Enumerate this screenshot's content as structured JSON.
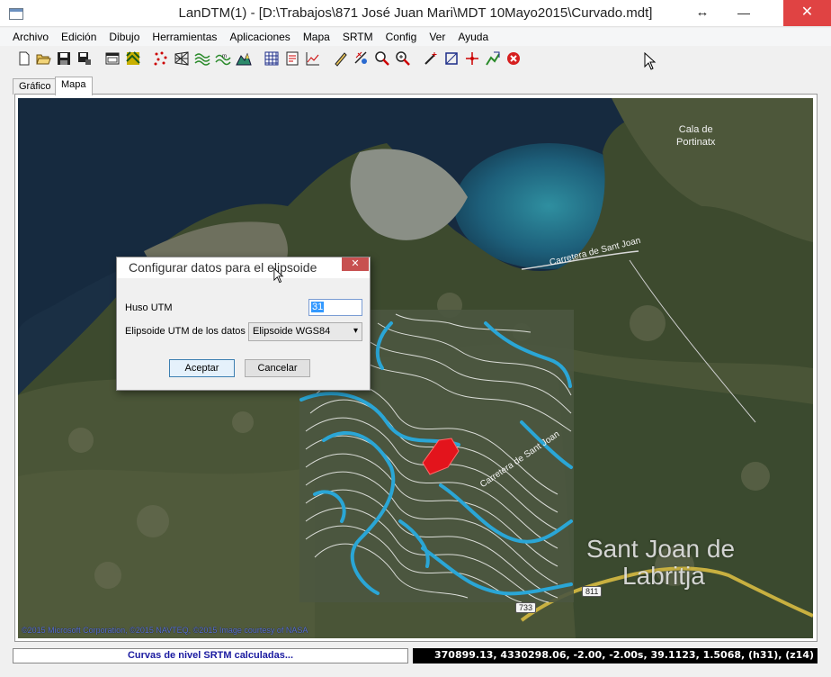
{
  "window": {
    "title": "LanDTM(1) - [D:\\Trabajos\\871 José Juan Mari\\MDT 10Mayo2015\\Curvado.mdt]",
    "resize_glyph": "↔",
    "minimize_glyph": "—",
    "maximize_glyph": "□",
    "close_glyph": "✕"
  },
  "menu": [
    "Archivo",
    "Edición",
    "Dibujo",
    "Herramientas",
    "Aplicaciones",
    "Mapa",
    "SRTM",
    "Config",
    "Ver",
    "Ayuda"
  ],
  "toolbar": {
    "icons": [
      "new-file-icon",
      "open-folder-icon",
      "save-icon",
      "save-as-icon",
      "window-icon",
      "texture-icon",
      "points-icon",
      "grid-mesh-icon",
      "contours-icon",
      "contour-labels-icon",
      "terrain-icon",
      "table-grid-icon",
      "report-icon",
      "profile-icon",
      "draw-pencil-icon",
      "measure-icon",
      "zoom-window-icon",
      "zoom-extents-icon",
      "magic-wand-icon",
      "select-frame-icon",
      "crosshair-icon",
      "edit-terrain-icon",
      "stop-icon"
    ]
  },
  "tabs": [
    {
      "label": "Gráfico",
      "active": false
    },
    {
      "label": "Mapa",
      "active": true
    }
  ],
  "map": {
    "place_cala": "Cala de Portinatx",
    "place_cala_line1": "Cala de",
    "place_cala_line2": "Portinatx",
    "town": "Sant Joan de Labritja",
    "town_line1": "Sant Joan de",
    "town_line2": "Labritja",
    "road_label_1": "Carretera de Sant Joan",
    "road_label_2": "Carretera de Sant Joan",
    "road_shield_1": "811",
    "road_shield_2": "733",
    "copyright": "©2015 Microsoft Corporation, ©2015 NAVTEQ, ©2015 Image courtesy of NASA",
    "colors": {
      "contour_major": "#2aa6d6",
      "contour_minor": "#ffffff",
      "highlight": "#e3141c",
      "road": "#c8b040"
    }
  },
  "dialog": {
    "title": "Configurar datos para el elipsoide",
    "close_glyph": "✕",
    "huso_label": "Huso UTM",
    "huso_value": "31",
    "ellipsoid_label": "Elipsoide UTM de los datos",
    "ellipsoid_value": "Elipsoide WGS84",
    "ok_label": "Aceptar",
    "cancel_label": "Cancelar"
  },
  "status": {
    "message": "Curvas de nivel SRTM calculadas...",
    "coordinates": "370899.13, 4330298.06, -2.00, -2.00s, 39.1123, 1.5068, (h31), (z14)"
  }
}
